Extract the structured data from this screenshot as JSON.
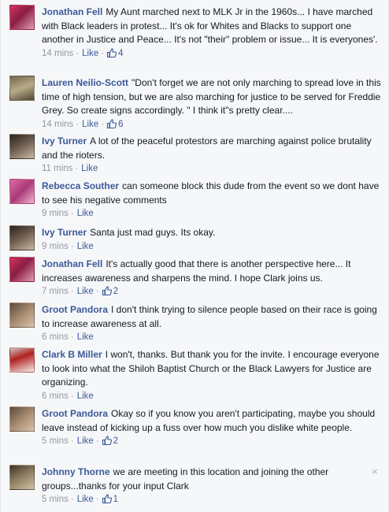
{
  "comments": [
    {
      "author": "Jonathan Fell",
      "body": "My Aunt marched next to MLK Jr in the 1960s... I have marched with Black leaders in protest... It's ok for Whites and Blacks to support one another in Justice and Peace... It's not \"their\" problem or issue... It is everyones'.",
      "time": "14 mins",
      "like_label": "Like",
      "like_count": "4"
    },
    {
      "author": "Lauren Neilio-Scott",
      "body": "\"Don't forget we are not only marching to spread love in this time of high tension, but we are also marching for justice to be served for Freddie Grey. So create signs accordingly. \" I think it\"s pretty clear....",
      "time": "14 mins",
      "like_label": "Like",
      "like_count": "6"
    },
    {
      "author": "Ivy Turner",
      "body": "A lot of the peaceful protestors are marching against police brutality and the rioters.",
      "time": "11 mins",
      "like_label": "Like",
      "like_count": ""
    },
    {
      "author": "Rebecca Souther",
      "body": "can someone block this dude from the event so we dont have to see his negative comments",
      "time": "9 mins",
      "like_label": "Like",
      "like_count": ""
    },
    {
      "author": "Ivy Turner",
      "body": "Santa just mad guys. Its okay.",
      "time": "9 mins",
      "like_label": "Like",
      "like_count": ""
    },
    {
      "author": "Jonathan Fell",
      "body": "It's actually good that there is another perspective here... It increases awareness and sharpens the mind. I hope Clark joins us.",
      "time": "7 mins",
      "like_label": "Like",
      "like_count": "2"
    },
    {
      "author": "Groot Pandora",
      "body": "I don't think trying to silence people based on their race is going to increase awareness at all.",
      "time": "6 mins",
      "like_label": "Like",
      "like_count": ""
    },
    {
      "author": "Clark B Miller",
      "body": "I won't, thanks. But thank you for the invite. I encourage everyone to look into what the Shiloh Baptist Church or the Black Lawyers for Justice are organizing.",
      "time": "6 mins",
      "like_label": "Like",
      "like_count": ""
    },
    {
      "author": "Groot Pandora",
      "body": "Okay so if you know you aren't participating, maybe you should leave instead of kicking up a fuss over how much you dislike white people.",
      "time": "5 mins",
      "like_label": "Like",
      "like_count": "2"
    },
    {
      "author": "Johnny Thorne",
      "body": "we are meeting in this location and joining the other groups...thanks for your input Clark",
      "time": "5 mins",
      "like_label": "Like",
      "like_count": "1"
    }
  ],
  "separator": "·",
  "close_glyph": "×",
  "colors": {
    "author_link": "#3b5998",
    "meta_text": "#9197a3",
    "background": "#f6f7f9"
  },
  "icons": {
    "like_count": "thumbs-up-icon",
    "remove": "close-icon"
  }
}
